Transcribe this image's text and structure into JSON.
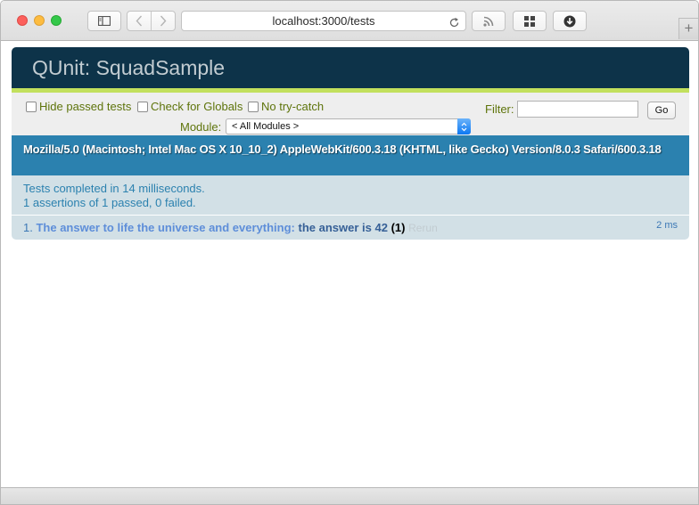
{
  "browser": {
    "address": "localhost:3000/tests",
    "icons": {
      "sidebar": "sidebar-icon",
      "back": "chevron-left-icon",
      "forward": "chevron-right-icon",
      "reload": "reload-icon",
      "rss": "rss-icon",
      "topsites": "grid-icon",
      "downloads": "download-icon",
      "new_tab": "plus-icon"
    },
    "new_tab_label": "+"
  },
  "qunit": {
    "title": "QUnit: SquadSample",
    "toolbar": {
      "hide_passed": "Hide passed tests",
      "check_globals": "Check for Globals",
      "no_try_catch": "No try-catch",
      "module_label": "Module:",
      "module_value": "< All Modules >",
      "filter_label": "Filter:",
      "filter_value": "",
      "go_label": "Go"
    },
    "useragent": "Mozilla/5.0 (Macintosh; Intel Mac OS X 10_10_2) AppleWebKit/600.3.18 (KHTML, like Gecko) Version/8.0.3 Safari/600.3.18",
    "result": {
      "line1": "Tests completed in 14 milliseconds.",
      "line2": "1 assertions of 1 passed, 0 failed."
    },
    "tests": [
      {
        "number": "1.",
        "module": "The answer to life the universe and everything:",
        "name": "the answer is 42",
        "counts": "(1)",
        "rerun": "Rerun",
        "runtime": "2 ms"
      }
    ]
  },
  "colors": {
    "header_bg": "#0d3349",
    "header_accent": "#c2e05d",
    "useragent_bg": "#2b81af",
    "result_bg": "#d2e0e6",
    "toolbar_text": "#5e740b"
  }
}
